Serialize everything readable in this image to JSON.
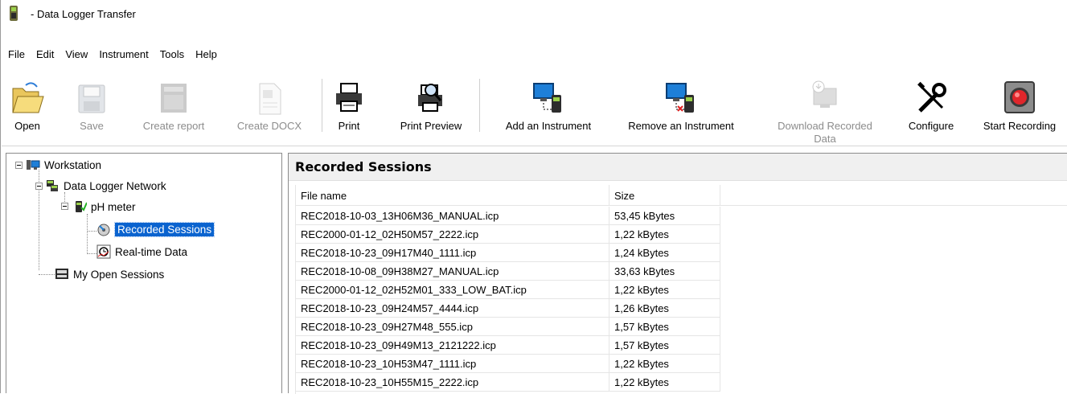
{
  "window": {
    "title": "- Data Logger Transfer"
  },
  "menu": [
    "File",
    "Edit",
    "View",
    "Instrument",
    "Tools",
    "Help"
  ],
  "toolbar": [
    {
      "label": "Open",
      "icon": "folder-open-icon",
      "enabled": true
    },
    {
      "label": "Save",
      "icon": "floppy-disk-icon",
      "enabled": false
    },
    {
      "label": "Create report",
      "icon": "report-icon",
      "enabled": false
    },
    {
      "label": "Create DOCX",
      "icon": "word-document-icon",
      "enabled": false
    },
    {
      "label": "Print",
      "icon": "printer-icon",
      "enabled": true
    },
    {
      "label": "Print Preview",
      "icon": "print-preview-icon",
      "enabled": true
    },
    {
      "label": "Add an Instrument",
      "icon": "add-instrument-icon",
      "enabled": true
    },
    {
      "label": "Remove an Instrument",
      "icon": "remove-instrument-icon",
      "enabled": true
    },
    {
      "label": "Download Recorded\nData",
      "icon": "download-data-icon",
      "enabled": false
    },
    {
      "label": "Configure",
      "icon": "wrench-screwdriver-icon",
      "enabled": true
    },
    {
      "label": "Start Recording",
      "icon": "record-button-icon",
      "enabled": true
    }
  ],
  "tree": {
    "workstation": "Workstation",
    "network": "Data Logger Network",
    "instrument": "pH meter",
    "recorded_sessions": "Recorded Sessions",
    "realtime": "Real-time Data",
    "open_sessions": "My Open Sessions"
  },
  "panel": {
    "title": "Recorded Sessions",
    "columns": [
      "File name",
      "Size"
    ],
    "rows": [
      [
        "REC2018-10-03_13H06M36_MANUAL.icp",
        "53,45 kBytes"
      ],
      [
        "REC2000-01-12_02H50M57_2222.icp",
        "1,22 kBytes"
      ],
      [
        "REC2018-10-23_09H17M40_1111.icp",
        "1,24 kBytes"
      ],
      [
        "REC2018-10-08_09H38M27_MANUAL.icp",
        "33,63 kBytes"
      ],
      [
        "REC2000-01-12_02H52M01_333_LOW_BAT.icp",
        "1,22 kBytes"
      ],
      [
        "REC2018-10-23_09H24M57_4444.icp",
        "1,26 kBytes"
      ],
      [
        "REC2018-10-23_09H27M48_555.icp",
        "1,57 kBytes"
      ],
      [
        "REC2018-10-23_09H49M13_2121222.icp",
        "1,57 kBytes"
      ],
      [
        "REC2018-10-23_10H53M47_1111.icp",
        "1,22 kBytes"
      ],
      [
        "REC2018-10-23_10H55M15_2222.icp",
        "1,22 kBytes"
      ]
    ]
  },
  "colors": {
    "selection": "#0a63cf",
    "disabled_text": "#8c8c8c"
  }
}
